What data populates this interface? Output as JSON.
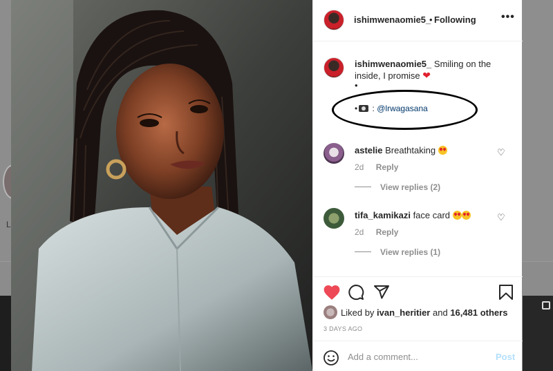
{
  "header": {
    "username": "ishimwenaomie5_",
    "separator": "•",
    "follow_status": "Following",
    "more_icon": "more-horizontal-icon"
  },
  "caption": {
    "username": "ishimwenaomie5_",
    "text": "Smiling on the inside, I promise",
    "bullet": "•",
    "credit_prefix": "•",
    "credit_sep": ":",
    "credit_handle": "@lrwagasana"
  },
  "comments": [
    {
      "username": "astelie",
      "text": "Breathtaking",
      "time": "2d",
      "reply_label": "Reply",
      "view_replies": "View replies (2)"
    },
    {
      "username": "tifa_kamikazi",
      "text": "face card",
      "time": "2d",
      "reply_label": "Reply",
      "view_replies": "View replies (1)"
    }
  ],
  "actions": {
    "liked_by_prefix": "Liked by",
    "liked_by_user": "ivan_heritier",
    "and": "and",
    "others": "16,481 others",
    "date": "3 DAYS AGO",
    "icons": [
      "heart-icon",
      "comment-icon",
      "share-icon",
      "bookmark-icon"
    ],
    "like_color": "#ed4956"
  },
  "add_comment": {
    "placeholder": "Add a comment...",
    "post_label": "Post"
  },
  "backdrop": {
    "partial_letter": "L"
  }
}
